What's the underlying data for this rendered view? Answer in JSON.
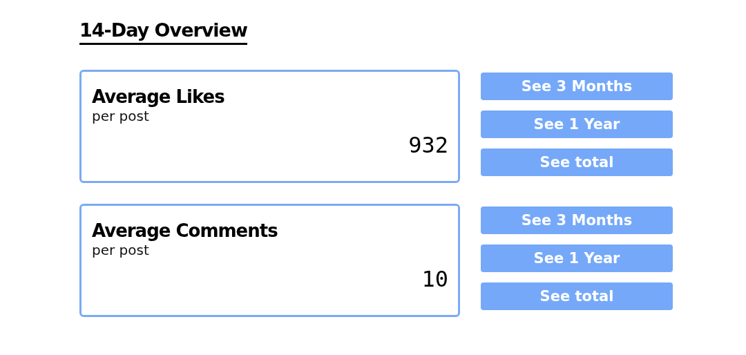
{
  "title": "14-Day Overview",
  "stats": [
    {
      "title": "Average Likes",
      "subtitle": "per post",
      "value": "932",
      "buttons": [
        "See 3 Months",
        "See 1 Year",
        "See total"
      ]
    },
    {
      "title": "Average Comments",
      "subtitle": "per post",
      "value": "10",
      "buttons": [
        "See 3 Months",
        "See 1 Year",
        "See total"
      ]
    }
  ]
}
